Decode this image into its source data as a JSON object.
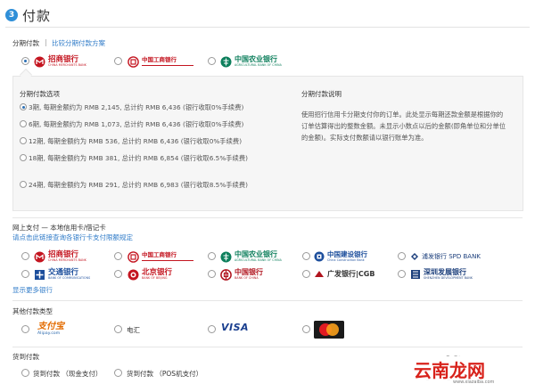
{
  "header": {
    "step": "3",
    "title": "付款"
  },
  "installment": {
    "label": "分期付款",
    "compare_link": "比较分期付款方案",
    "banks": [
      {
        "name": "招商银行",
        "en": "CHINA MERCHANTS BANK",
        "selected": true,
        "color": "#c41520",
        "icon": "cmb-logo-icon"
      },
      {
        "name": "中国工商银行",
        "en": "",
        "selected": false,
        "color": "#c41520",
        "icon": "icbc-logo-icon"
      },
      {
        "name": "中国农业银行",
        "en": "AGRICULTURAL BANK OF CHINA",
        "selected": false,
        "color": "#0d7f5c",
        "icon": "abc-logo-icon"
      }
    ],
    "options_title": "分期付款选项",
    "options": [
      {
        "text": "3期, 每期金额约为 RMB 2,145, 总计约 RMB 6,436 (银行收取0%手续费)",
        "selected": true
      },
      {
        "text": "6期, 每期金额约为 RMB 1,073, 总计约 RMB 6,436 (银行收取0%手续费)",
        "selected": false
      },
      {
        "text": "12期, 每期金额约为 RMB 536, 总计约 RMB 6,436 (银行收取0%手续费)",
        "selected": false
      },
      {
        "text": "18期, 每期金额约为 RMB 381, 总计约 RMB 6,854 (银行收取6.5%手续费)",
        "selected": false
      },
      {
        "text": "24期, 每期金额约为 RMB 291, 总计约 RMB 6,983 (银行收取8.5%手续费)",
        "selected": false
      }
    ],
    "explain_title": "分期付款说明",
    "explain_text": "使用招行信用卡分期支付你的订单。此处显示每期还款金额是根据你的订单估算得出的整数金额。未显示小数点以后的金额(即角单位和分单位的金额)。实际支付数额请以银行账单为准。"
  },
  "online": {
    "label": "网上支付 — 本地信用卡/借记卡",
    "limit_link": "请点击此链接查询各银行卡支付限额规定",
    "banks": [
      {
        "name": "招商银行",
        "en": "CHINA MERCHANTS BANK",
        "color": "#c41520",
        "icon": "cmb-logo-icon"
      },
      {
        "name": "中国工商银行",
        "en": "",
        "color": "#c41520",
        "icon": "icbc-logo-icon"
      },
      {
        "name": "中国农业银行",
        "en": "AGRICULTURAL BANK OF CHINA",
        "color": "#0d7f5c",
        "icon": "abc-logo-icon"
      },
      {
        "name": "中国建设银行",
        "en": "China Construction Bank",
        "color": "#1c4e9c",
        "icon": "ccb-logo-icon"
      },
      {
        "name": "浦发银行 SPD BANK",
        "en": "",
        "color": "#1c3f7c",
        "icon": "spdb-logo-icon"
      },
      {
        "name": "交通银行",
        "en": "BANK OF COMMUNICATIONS",
        "color": "#1c4e9c",
        "icon": "bocom-logo-icon"
      },
      {
        "name": "北京银行",
        "en": "BANK OF BEIJING",
        "color": "#c41520",
        "icon": "bob-logo-icon"
      },
      {
        "name": "中国银行",
        "en": "BANK OF CHINA",
        "color": "#b0141e",
        "icon": "boc-logo-icon"
      },
      {
        "name": "广发银行|CGB",
        "en": "",
        "color": "#b0141e",
        "icon": "cgb-logo-icon"
      },
      {
        "name": "深圳发展银行",
        "en": "SHENZHEN DEVELOPMENT BANK",
        "color": "#1c3f7c",
        "icon": "sdb-logo-icon"
      }
    ],
    "more_link": "显示更多银行"
  },
  "other": {
    "label": "其他付款类型",
    "items": [
      {
        "name": "支付宝",
        "sub": "Alipay.com",
        "icon": "alipay-logo-icon"
      },
      {
        "name": "电汇",
        "icon": ""
      },
      {
        "name": "VISA",
        "icon": "visa-logo-icon"
      },
      {
        "name": "MasterCard",
        "icon": "mastercard-logo-icon"
      }
    ]
  },
  "cod": {
    "label": "货到付款",
    "items": [
      {
        "name": "货到付款 （现金支付）"
      },
      {
        "name": "货到付款 （POS机支付）"
      }
    ]
  },
  "watermark": {
    "top": "下载吧",
    "main": "云南龙网",
    "url": "www.xiazaiba.com"
  }
}
